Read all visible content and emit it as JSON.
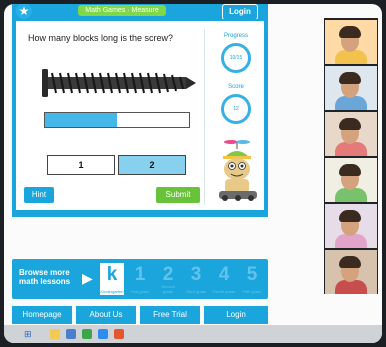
{
  "top_bar": {
    "title": "Math Games · Measure",
    "login_label": "Login"
  },
  "question": {
    "text": "How many blocks long is the screw?",
    "ruler_fill_fraction": 0.5,
    "answers": [
      "1",
      "2"
    ],
    "selected_answer": "2",
    "hint_label": "Hint",
    "submit_label": "Submit"
  },
  "progress": {
    "label": "Progress",
    "value": "10/15"
  },
  "score": {
    "label": "Score",
    "value": "12"
  },
  "browse": {
    "text": "Browse more math lessons",
    "levels": [
      {
        "label": "k",
        "sub": "Kindergarten",
        "active": true
      },
      {
        "label": "1",
        "sub": "First grade",
        "active": false
      },
      {
        "label": "2",
        "sub": "Second grade",
        "active": false
      },
      {
        "label": "3",
        "sub": "Third grade",
        "active": false
      },
      {
        "label": "4",
        "sub": "Fourth grade",
        "active": false
      },
      {
        "label": "5",
        "sub": "Fifth grade",
        "active": false
      }
    ]
  },
  "footer_nav": [
    "Homepage",
    "About Us",
    "Free Trial",
    "Login"
  ],
  "colors": {
    "accent": "#1aa6dd",
    "submit": "#68c23a",
    "ruler_fill": "#45b7e8",
    "selected_answer": "#87d1ef"
  },
  "video_tiles": [
    {
      "bg": "#ffd9a6",
      "shirt": "#f2c14e"
    },
    {
      "bg": "#dfe7ee",
      "shirt": "#6aa6d8"
    },
    {
      "bg": "#e7d8c9",
      "shirt": "#e47a7a"
    },
    {
      "bg": "#f1efe4",
      "shirt": "#79c16b"
    },
    {
      "bg": "#e6dde9",
      "shirt": "#e2a5c9"
    },
    {
      "bg": "#d6c2ad",
      "shirt": "#c84d4d"
    }
  ]
}
